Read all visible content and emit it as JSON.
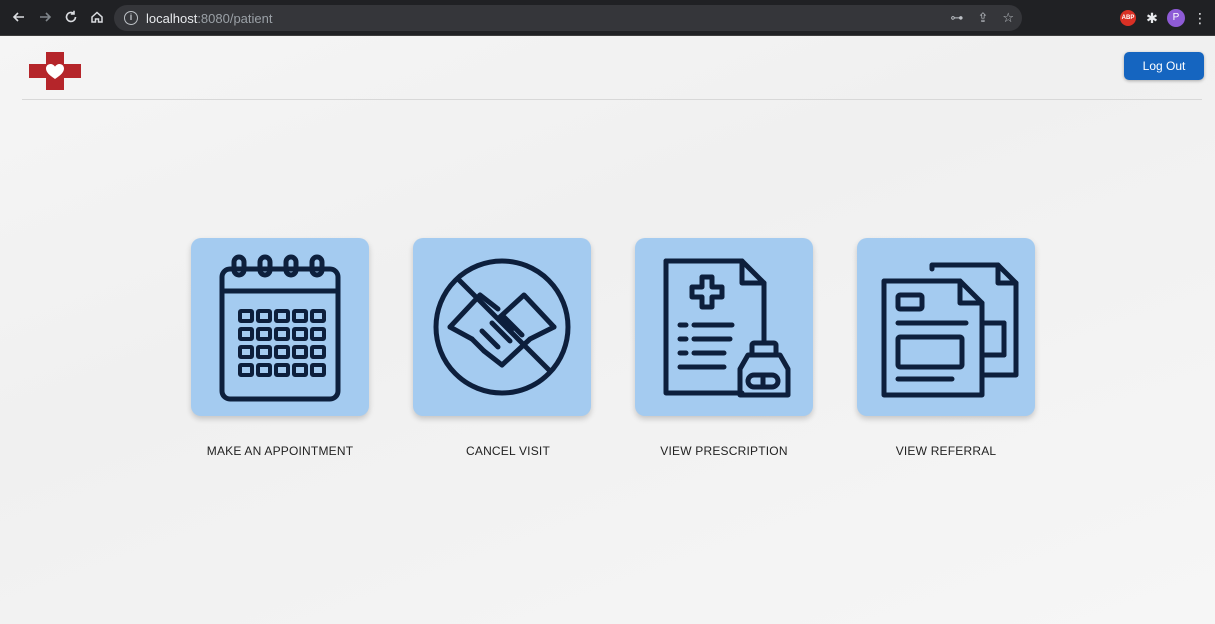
{
  "browser": {
    "url_host": "localhost",
    "url_path": ":8080/patient",
    "profile_initial": "P",
    "abp_label": "ABP"
  },
  "header": {
    "logout_label": "Log Out"
  },
  "actions": [
    {
      "label": "MAKE AN APPOINTMENT",
      "icon": "calendar-icon"
    },
    {
      "label": "CANCEL VISIT",
      "icon": "cancelled-handshake-icon"
    },
    {
      "label": "VIEW PRESCRIPTION",
      "icon": "prescription-icon"
    },
    {
      "label": "VIEW REFERRAL",
      "icon": "referral-documents-icon"
    }
  ],
  "colors": {
    "tile_background": "#a4cbf0",
    "icon_stroke": "#0d1f3c",
    "button_blue": "#1565c0",
    "logo_red": "#b5252a"
  }
}
